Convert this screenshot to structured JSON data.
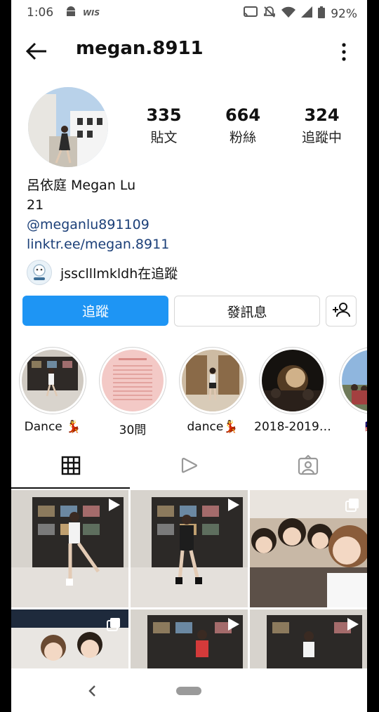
{
  "status_bar": {
    "time": "1:06",
    "battery": "92%"
  },
  "header": {
    "username": "megan.8911"
  },
  "stats": [
    {
      "value": "335",
      "label": "貼文"
    },
    {
      "value": "664",
      "label": "粉絲"
    },
    {
      "value": "324",
      "label": "追蹤中"
    }
  ],
  "bio": {
    "name": "呂依庭 Megan Lu",
    "age": "21",
    "handle": "@meganlu891109",
    "link": "linktr.ee/megan.8911"
  },
  "followed_by": {
    "text": "jssclllmkldh在追蹤"
  },
  "actions": {
    "follow": "追蹤",
    "message": "發訊息"
  },
  "highlights": [
    {
      "label": "Dance 💃"
    },
    {
      "label": "30問"
    },
    {
      "label": "dance💃"
    },
    {
      "label": "2018-2019…"
    },
    {
      "label": "🇲🇾"
    }
  ],
  "colors": {
    "primary": "#1e95f4",
    "link": "#1b3f78"
  }
}
